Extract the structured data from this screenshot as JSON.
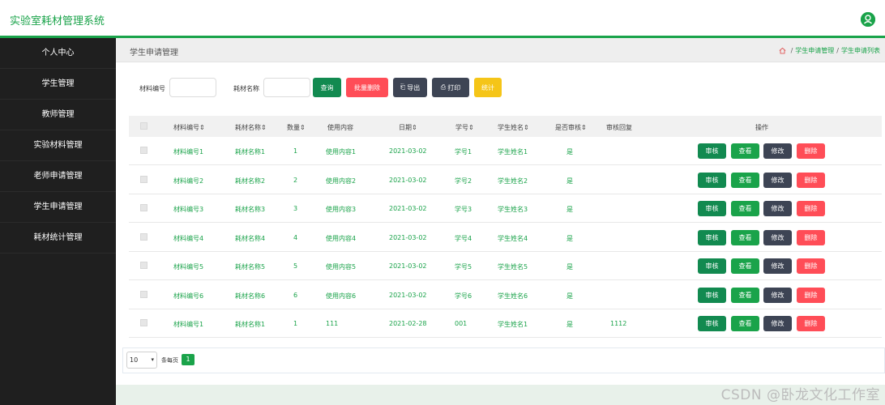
{
  "app": {
    "title": "实验室耗材管理系统"
  },
  "sidebar": {
    "items": [
      {
        "label": "个人中心"
      },
      {
        "label": "学生管理"
      },
      {
        "label": "教师管理"
      },
      {
        "label": "实验材料管理"
      },
      {
        "label": "老师申请管理"
      },
      {
        "label": "学生申请管理"
      },
      {
        "label": "耗材统计管理"
      }
    ]
  },
  "page": {
    "title": "学生申请管理",
    "breadcrumb": [
      "学生申请管理",
      "学生申请列表"
    ]
  },
  "filters": {
    "material_no_label": "材料编号",
    "material_name_label": "耗材名称",
    "material_no_value": "",
    "material_name_value": ""
  },
  "toolbar": {
    "query": "查询",
    "batch_delete": "批量删除",
    "export": "导出",
    "print": "打印",
    "stats": "统计"
  },
  "table": {
    "headers": [
      "材料编号",
      "耗材名称",
      "数量",
      "使用内容",
      "日期",
      "学号",
      "学生姓名",
      "是否审核",
      "审核回复",
      "操作"
    ],
    "rows": [
      {
        "no": "材料编号1",
        "name": "耗材名称1",
        "qty": "1",
        "content": "使用内容1",
        "date": "2021-03-02",
        "sid": "学号1",
        "sname": "学生姓名1",
        "approved": "是",
        "reply": ""
      },
      {
        "no": "材料编号2",
        "name": "耗材名称2",
        "qty": "2",
        "content": "使用内容2",
        "date": "2021-03-02",
        "sid": "学号2",
        "sname": "学生姓名2",
        "approved": "是",
        "reply": ""
      },
      {
        "no": "材料编号3",
        "name": "耗材名称3",
        "qty": "3",
        "content": "使用内容3",
        "date": "2021-03-02",
        "sid": "学号3",
        "sname": "学生姓名3",
        "approved": "是",
        "reply": ""
      },
      {
        "no": "材料编号4",
        "name": "耗材名称4",
        "qty": "4",
        "content": "使用内容4",
        "date": "2021-03-02",
        "sid": "学号4",
        "sname": "学生姓名4",
        "approved": "是",
        "reply": ""
      },
      {
        "no": "材料编号5",
        "name": "耗材名称5",
        "qty": "5",
        "content": "使用内容5",
        "date": "2021-03-02",
        "sid": "学号5",
        "sname": "学生姓名5",
        "approved": "是",
        "reply": ""
      },
      {
        "no": "材料编号6",
        "name": "耗材名称6",
        "qty": "6",
        "content": "使用内容6",
        "date": "2021-03-02",
        "sid": "学号6",
        "sname": "学生姓名6",
        "approved": "是",
        "reply": ""
      },
      {
        "no": "材料编号1",
        "name": "耗材名称1",
        "qty": "1",
        "content": "111",
        "date": "2021-02-28",
        "sid": "001",
        "sname": "学生姓名1",
        "approved": "是",
        "reply": "1112"
      }
    ],
    "actions": {
      "review": "审核",
      "view": "查看",
      "edit": "修改",
      "delete": "删除"
    }
  },
  "pagination": {
    "page_size": "10",
    "per_page_label": "条每页",
    "current_page": "1"
  },
  "watermark": "CSDN @卧龙文化工作室",
  "colors": {
    "accent": "#1aa34a",
    "sidebar_bg": "#1f1f1f",
    "review": "#128a50",
    "view": "#1aa34a",
    "edit": "#3d4454",
    "delete": "#ff4d57",
    "batch_delete": "#ff4d57",
    "export": "#3d4454",
    "print": "#3d4454",
    "stats": "#f5c518"
  }
}
